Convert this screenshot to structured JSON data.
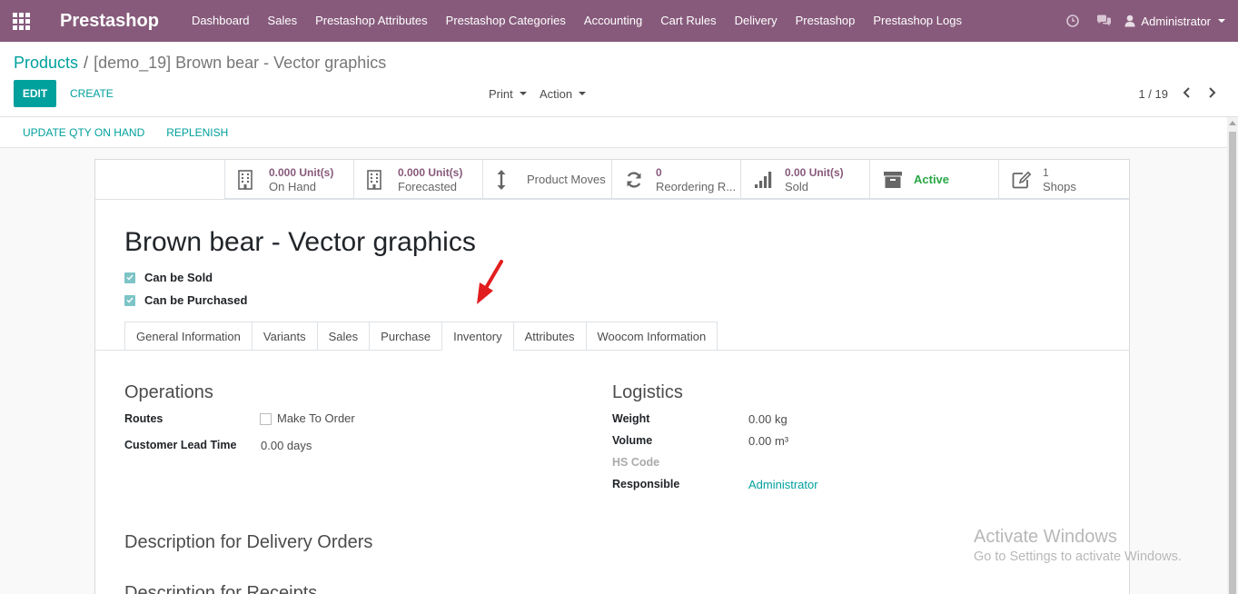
{
  "navbar": {
    "brand": "Prestashop",
    "menu": [
      "Dashboard",
      "Sales",
      "Prestashop Attributes",
      "Prestashop Categories",
      "Accounting",
      "Cart Rules",
      "Delivery",
      "Prestashop",
      "Prestashop Logs"
    ],
    "user": "Administrator",
    "icons": [
      "apps-icon",
      "clock-icon",
      "chat-icon",
      "user-icon"
    ]
  },
  "breadcrumb": {
    "parent": "Products",
    "separator": "/",
    "current": "[demo_19] Brown bear - Vector graphics"
  },
  "control": {
    "edit": "EDIT",
    "create": "CREATE",
    "print": "Print",
    "action": "Action",
    "pager": "1 / 19"
  },
  "statusbar": {
    "update_qty": "UPDATE QTY ON HAND",
    "replenish": "REPLENISH"
  },
  "smart_buttons": [
    {
      "value": "0.000 Unit(s)",
      "label": "On Hand",
      "icon": "building-icon"
    },
    {
      "value": "0.000 Unit(s)",
      "label": "Forecasted",
      "icon": "building-icon"
    },
    {
      "value": "",
      "label": "Product Moves",
      "icon": "arrows-vertical-icon"
    },
    {
      "value": "0",
      "label": "Reordering R...",
      "icon": "refresh-icon"
    },
    {
      "value": "0.00 Unit(s)",
      "label": "Sold",
      "icon": "signal-icon"
    },
    {
      "value": "",
      "label": "Active",
      "icon": "archive-icon"
    },
    {
      "value": "1",
      "label": "Shops",
      "icon": "edit-icon"
    }
  ],
  "product": {
    "name": "Brown bear - Vector graphics",
    "can_be_sold": "Can be Sold",
    "can_be_purchased": "Can be Purchased"
  },
  "tabs": [
    "General Information",
    "Variants",
    "Sales",
    "Purchase",
    "Inventory",
    "Attributes",
    "Woocom Information"
  ],
  "active_tab": "Inventory",
  "operations": {
    "title": "Operations",
    "routes_label": "Routes",
    "routes_value": "Make To Order",
    "lead_time_label": "Customer Lead Time",
    "lead_time_value": "0.00 days"
  },
  "logistics": {
    "title": "Logistics",
    "weight_label": "Weight",
    "weight_value": "0.00",
    "weight_unit": "kg",
    "volume_label": "Volume",
    "volume_value": "0.00",
    "volume_unit": "m³",
    "hs_label": "HS Code",
    "responsible_label": "Responsible",
    "responsible_value": "Administrator"
  },
  "sections": {
    "delivery": "Description for Delivery Orders",
    "receipts": "Description for Receipts"
  },
  "watermark": {
    "line1": "Activate Windows",
    "line2": "Go to Settings to activate Windows."
  }
}
